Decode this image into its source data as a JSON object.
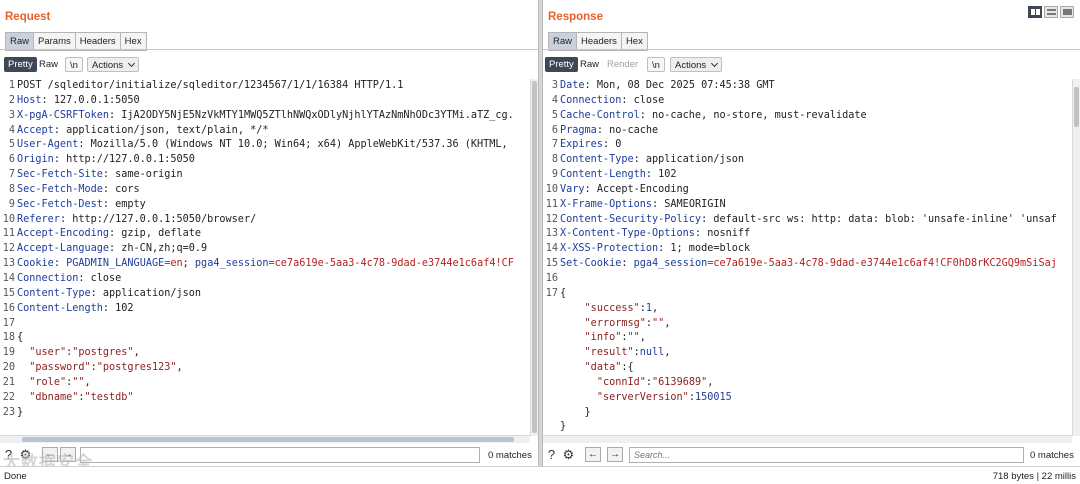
{
  "request": {
    "title": "Request",
    "tabs": [
      "Raw",
      "Params",
      "Headers",
      "Hex"
    ],
    "active_tab": 0,
    "toolbar": {
      "pretty": "Pretty",
      "raw": "Raw",
      "newline": "\\n",
      "actions": "Actions"
    },
    "lines": [
      [
        {
          "t": "POST /sqleditor/initialize/sqleditor/1234567/1/1/16384 HTTP/1.1",
          "c": "hv"
        }
      ],
      [
        {
          "t": "Host",
          "c": "hn"
        },
        {
          "t": ": 127.0.0.1:5050",
          "c": "hv"
        }
      ],
      [
        {
          "t": "X-pgA-CSRFToken",
          "c": "hn"
        },
        {
          "t": ": IjA2ODY5NjE5NzVkMTY1MWQ5ZTlhNWQxODlyNjhlYTAzNmNhODc3YTMi.aTZ_cg.",
          "c": "hv"
        }
      ],
      [
        {
          "t": "Accept",
          "c": "hn"
        },
        {
          "t": ": application/json, text/plain, */*",
          "c": "hv"
        }
      ],
      [
        {
          "t": "User-Agent",
          "c": "hn"
        },
        {
          "t": ": Mozilla/5.0 (Windows NT 10.0; Win64; x64) AppleWebKit/537.36 (KHTML,",
          "c": "hv"
        }
      ],
      [
        {
          "t": "Origin",
          "c": "hn"
        },
        {
          "t": ": http://127.0.0.1:5050",
          "c": "hv"
        }
      ],
      [
        {
          "t": "Sec-Fetch-Site",
          "c": "hn"
        },
        {
          "t": ": same-origin",
          "c": "hv"
        }
      ],
      [
        {
          "t": "Sec-Fetch-Mode",
          "c": "hn"
        },
        {
          "t": ": cors",
          "c": "hv"
        }
      ],
      [
        {
          "t": "Sec-Fetch-Dest",
          "c": "hn"
        },
        {
          "t": ": empty",
          "c": "hv"
        }
      ],
      [
        {
          "t": "Referer",
          "c": "hn"
        },
        {
          "t": ": http://127.0.0.1:5050/browser/",
          "c": "hv"
        }
      ],
      [
        {
          "t": "Accept-Encoding",
          "c": "hn"
        },
        {
          "t": ": gzip, deflate",
          "c": "hv"
        }
      ],
      [
        {
          "t": "Accept-Language",
          "c": "hn"
        },
        {
          "t": ": zh-CN,zh;q=0.9",
          "c": "hv"
        }
      ],
      [
        {
          "t": "Cookie",
          "c": "hn"
        },
        {
          "t": ": ",
          "c": "hv"
        },
        {
          "t": "PGADMIN_LANGUAGE",
          "c": "ck"
        },
        {
          "t": "=en",
          "c": "cv"
        },
        {
          "t": "; ",
          "c": "hv"
        },
        {
          "t": "pga4_session",
          "c": "ck"
        },
        {
          "t": "=ce7a619e-5aa3-4c78-9dad-e3744e1c6af4!CF",
          "c": "cv"
        }
      ],
      [
        {
          "t": "Connection",
          "c": "hn"
        },
        {
          "t": ": close",
          "c": "hv"
        }
      ],
      [
        {
          "t": "Content-Type",
          "c": "hn"
        },
        {
          "t": ": application/json",
          "c": "hv"
        }
      ],
      [
        {
          "t": "Content-Length",
          "c": "hn"
        },
        {
          "t": ": 102",
          "c": "hv"
        }
      ],
      [],
      [
        {
          "t": "{",
          "c": "js-pun"
        }
      ],
      [
        {
          "t": "  ",
          "c": "js-pun"
        },
        {
          "t": "\"user\"",
          "c": "js-key"
        },
        {
          "t": ":",
          "c": "js-pun"
        },
        {
          "t": "\"postgres\"",
          "c": "js-str"
        },
        {
          "t": ",",
          "c": "js-pun"
        }
      ],
      [
        {
          "t": "  ",
          "c": "js-pun"
        },
        {
          "t": "\"password\"",
          "c": "js-key"
        },
        {
          "t": ":",
          "c": "js-pun"
        },
        {
          "t": "\"postgres123\"",
          "c": "js-str"
        },
        {
          "t": ",",
          "c": "js-pun"
        }
      ],
      [
        {
          "t": "  ",
          "c": "js-pun"
        },
        {
          "t": "\"role\"",
          "c": "js-key"
        },
        {
          "t": ":",
          "c": "js-pun"
        },
        {
          "t": "\"\"",
          "c": "js-str"
        },
        {
          "t": ",",
          "c": "js-pun"
        }
      ],
      [
        {
          "t": "  ",
          "c": "js-pun"
        },
        {
          "t": "\"dbname\"",
          "c": "js-key"
        },
        {
          "t": ":",
          "c": "js-pun"
        },
        {
          "t": "\"testdb\"",
          "c": "js-str"
        }
      ],
      [
        {
          "t": "}",
          "c": "js-pun"
        }
      ]
    ],
    "line_start": 1,
    "search": {
      "placeholder": "",
      "matches": "0 matches"
    }
  },
  "response": {
    "title": "Response",
    "tabs": [
      "Raw",
      "Headers",
      "Hex"
    ],
    "active_tab": 0,
    "toolbar": {
      "pretty": "Pretty",
      "raw": "Raw",
      "render": "Render",
      "newline": "\\n",
      "actions": "Actions"
    },
    "lines": [
      [
        {
          "t": "Date",
          "c": "hn"
        },
        {
          "t": ": Mon, 08 Dec 2025 07:45:38 GMT",
          "c": "hv"
        }
      ],
      [
        {
          "t": "Connection",
          "c": "hn"
        },
        {
          "t": ": close",
          "c": "hv"
        }
      ],
      [
        {
          "t": "Cache-Control",
          "c": "hn"
        },
        {
          "t": ": no-cache, no-store, must-revalidate",
          "c": "hv"
        }
      ],
      [
        {
          "t": "Pragma",
          "c": "hn"
        },
        {
          "t": ": no-cache",
          "c": "hv"
        }
      ],
      [
        {
          "t": "Expires",
          "c": "hn"
        },
        {
          "t": ": 0",
          "c": "hv"
        }
      ],
      [
        {
          "t": "Content-Type",
          "c": "hn"
        },
        {
          "t": ": application/json",
          "c": "hv"
        }
      ],
      [
        {
          "t": "Content-Length",
          "c": "hn"
        },
        {
          "t": ": 102",
          "c": "hv"
        }
      ],
      [
        {
          "t": "Vary",
          "c": "hn"
        },
        {
          "t": ": Accept-Encoding",
          "c": "hv"
        }
      ],
      [
        {
          "t": "X-Frame-Options",
          "c": "hn"
        },
        {
          "t": ": SAMEORIGIN",
          "c": "hv"
        }
      ],
      [
        {
          "t": "Content-Security-Policy",
          "c": "hn"
        },
        {
          "t": ": default-src ws: http: data: blob: 'unsafe-inline' 'unsaf",
          "c": "hv"
        }
      ],
      [
        {
          "t": "X-Content-Type-Options",
          "c": "hn"
        },
        {
          "t": ": nosniff",
          "c": "hv"
        }
      ],
      [
        {
          "t": "X-XSS-Protection",
          "c": "hn"
        },
        {
          "t": ": 1; mode=block",
          "c": "hv"
        }
      ],
      [
        {
          "t": "Set-Cookie",
          "c": "hn"
        },
        {
          "t": ": ",
          "c": "hv"
        },
        {
          "t": "pga4_session",
          "c": "ck"
        },
        {
          "t": "=ce7a619e-5aa3-4c78-9dad-e3744e1c6af4!CF0hD8rKC2GQ9mSiSaj",
          "c": "cv"
        }
      ],
      [],
      [
        {
          "t": "{",
          "c": "js-pun"
        }
      ],
      [
        {
          "t": "    ",
          "c": "js-pun"
        },
        {
          "t": "\"success\"",
          "c": "js-key"
        },
        {
          "t": ":",
          "c": "js-pun"
        },
        {
          "t": "1",
          "c": "js-num"
        },
        {
          "t": ",",
          "c": "js-pun"
        }
      ],
      [
        {
          "t": "    ",
          "c": "js-pun"
        },
        {
          "t": "\"errormsg\"",
          "c": "js-key"
        },
        {
          "t": ":",
          "c": "js-pun"
        },
        {
          "t": "\"\"",
          "c": "js-str"
        },
        {
          "t": ",",
          "c": "js-pun"
        }
      ],
      [
        {
          "t": "    ",
          "c": "js-pun"
        },
        {
          "t": "\"info\"",
          "c": "js-key"
        },
        {
          "t": ":",
          "c": "js-pun"
        },
        {
          "t": "\"\"",
          "c": "js-str"
        },
        {
          "t": ",",
          "c": "js-pun"
        }
      ],
      [
        {
          "t": "    ",
          "c": "js-pun"
        },
        {
          "t": "\"result\"",
          "c": "js-key"
        },
        {
          "t": ":",
          "c": "js-pun"
        },
        {
          "t": "null",
          "c": "js-num"
        },
        {
          "t": ",",
          "c": "js-pun"
        }
      ],
      [
        {
          "t": "    ",
          "c": "js-pun"
        },
        {
          "t": "\"data\"",
          "c": "js-key"
        },
        {
          "t": ":{",
          "c": "js-pun"
        }
      ],
      [
        {
          "t": "      ",
          "c": "js-pun"
        },
        {
          "t": "\"connId\"",
          "c": "js-key"
        },
        {
          "t": ":",
          "c": "js-pun"
        },
        {
          "t": "\"6139689\"",
          "c": "js-str"
        },
        {
          "t": ",",
          "c": "js-pun"
        }
      ],
      [
        {
          "t": "      ",
          "c": "js-pun"
        },
        {
          "t": "\"serverVersion\"",
          "c": "js-key"
        },
        {
          "t": ":",
          "c": "js-pun"
        },
        {
          "t": "150015",
          "c": "js-num"
        }
      ],
      [
        {
          "t": "    }",
          "c": "js-pun"
        }
      ],
      [
        {
          "t": "}",
          "c": "js-pun"
        }
      ]
    ],
    "line_start": 3,
    "line_numbers_until": 17,
    "search": {
      "placeholder": "Search...",
      "matches": "0 matches"
    }
  },
  "status": {
    "left": "Done",
    "right": "718 bytes | 22 millis"
  },
  "watermark": "大数据安全",
  "colors": {
    "accent": "#e8612c",
    "dark_button": "#3d4756",
    "header_name": "#1d3d9e",
    "cookie_value": "#b52020"
  }
}
